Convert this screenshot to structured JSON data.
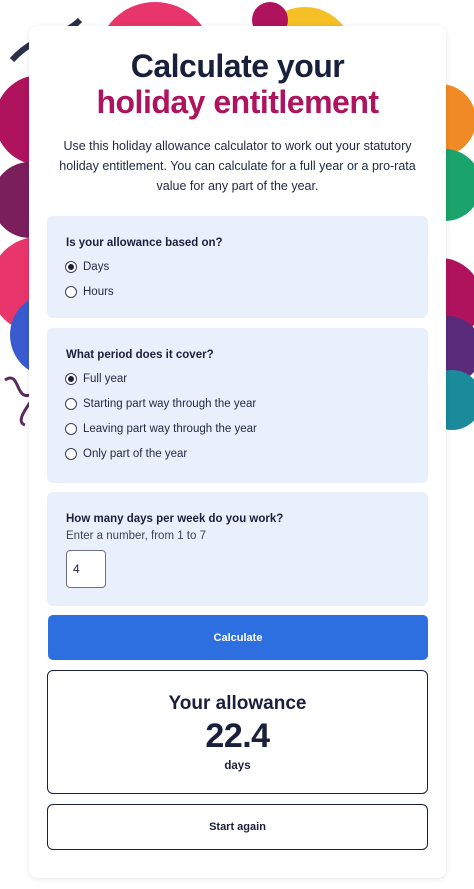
{
  "header": {
    "title_line1": "Calculate your",
    "title_line2": "holiday entitlement",
    "intro": "Use this holiday allowance calculator to work out your statutory holiday entitlement. You can calculate for a full year or a pro-rata value for any part of the year."
  },
  "basis": {
    "question": "Is your allowance based on?",
    "options": [
      {
        "label": "Days",
        "checked": true
      },
      {
        "label": "Hours",
        "checked": false
      }
    ]
  },
  "period": {
    "question": "What period does it cover?",
    "options": [
      {
        "label": "Full year",
        "checked": true
      },
      {
        "label": "Starting part way through the year",
        "checked": false
      },
      {
        "label": "Leaving part way through the year",
        "checked": false
      },
      {
        "label": "Only part of the year",
        "checked": false
      }
    ]
  },
  "days": {
    "question": "How many days per week do you work?",
    "hint": "Enter a number, from 1 to 7",
    "value": "4"
  },
  "actions": {
    "calculate_label": "Calculate",
    "start_again_label": "Start again"
  },
  "result": {
    "title": "Your allowance",
    "value": "22.4",
    "unit": "days"
  },
  "colors": {
    "heading": "#1a1f3c",
    "accent": "#b0135d",
    "button": "#2d6ee0",
    "panel": "#eaf0fb"
  }
}
